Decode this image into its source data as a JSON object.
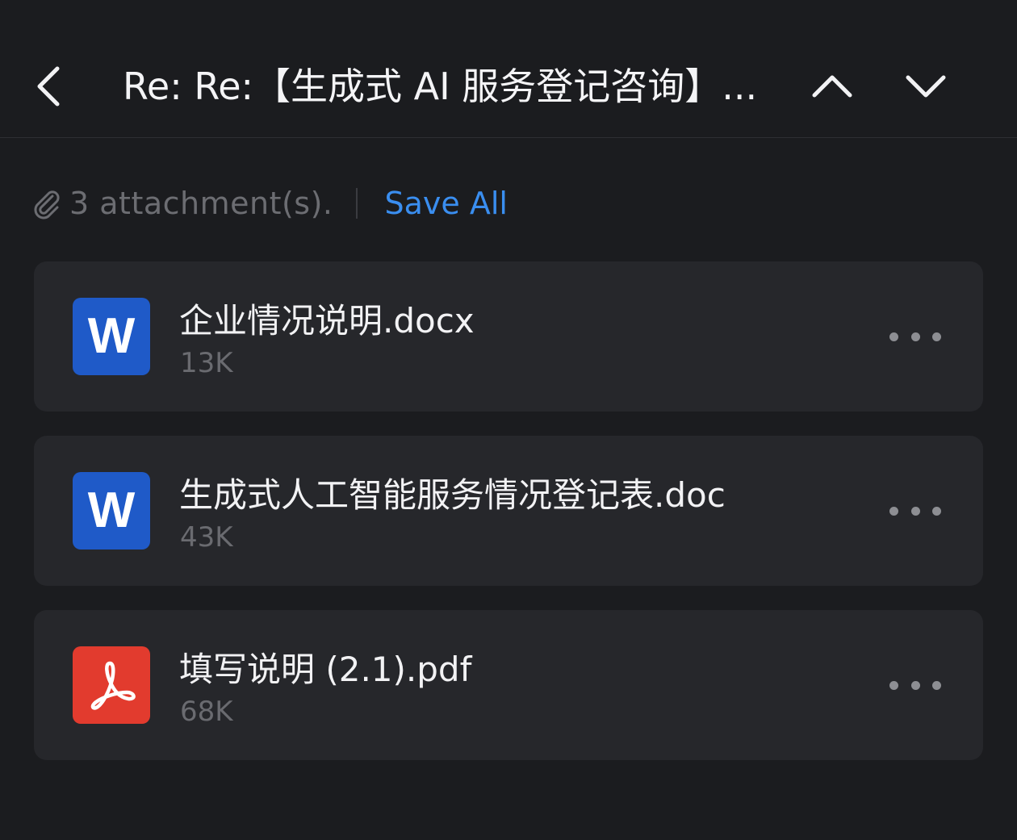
{
  "nav": {
    "title": "Re: Re:【生成式 AI 服务登记咨询】..."
  },
  "attachments_bar": {
    "count_text": "3 attachment(s).",
    "save_all_label": "Save All"
  },
  "attachments": [
    {
      "name": "企业情况说明.docx",
      "size": "13K",
      "type": "word",
      "icon_letter": "W"
    },
    {
      "name": "生成式人工智能服务情况登记表.doc",
      "size": "43K",
      "type": "word",
      "icon_letter": "W"
    },
    {
      "name": "填写说明 (2.1).pdf",
      "size": "68K",
      "type": "pdf"
    }
  ],
  "colors": {
    "background": "#1b1c1f",
    "card": "#26272b",
    "accent": "#3a8ef0",
    "word_icon": "#1f5ac8",
    "pdf_icon": "#e23b2e"
  },
  "icons": {
    "back": "chevron-left-icon",
    "prev": "chevron-up-icon",
    "next": "chevron-down-icon",
    "attachment": "paperclip-icon",
    "more": "more-horizontal-icon"
  }
}
